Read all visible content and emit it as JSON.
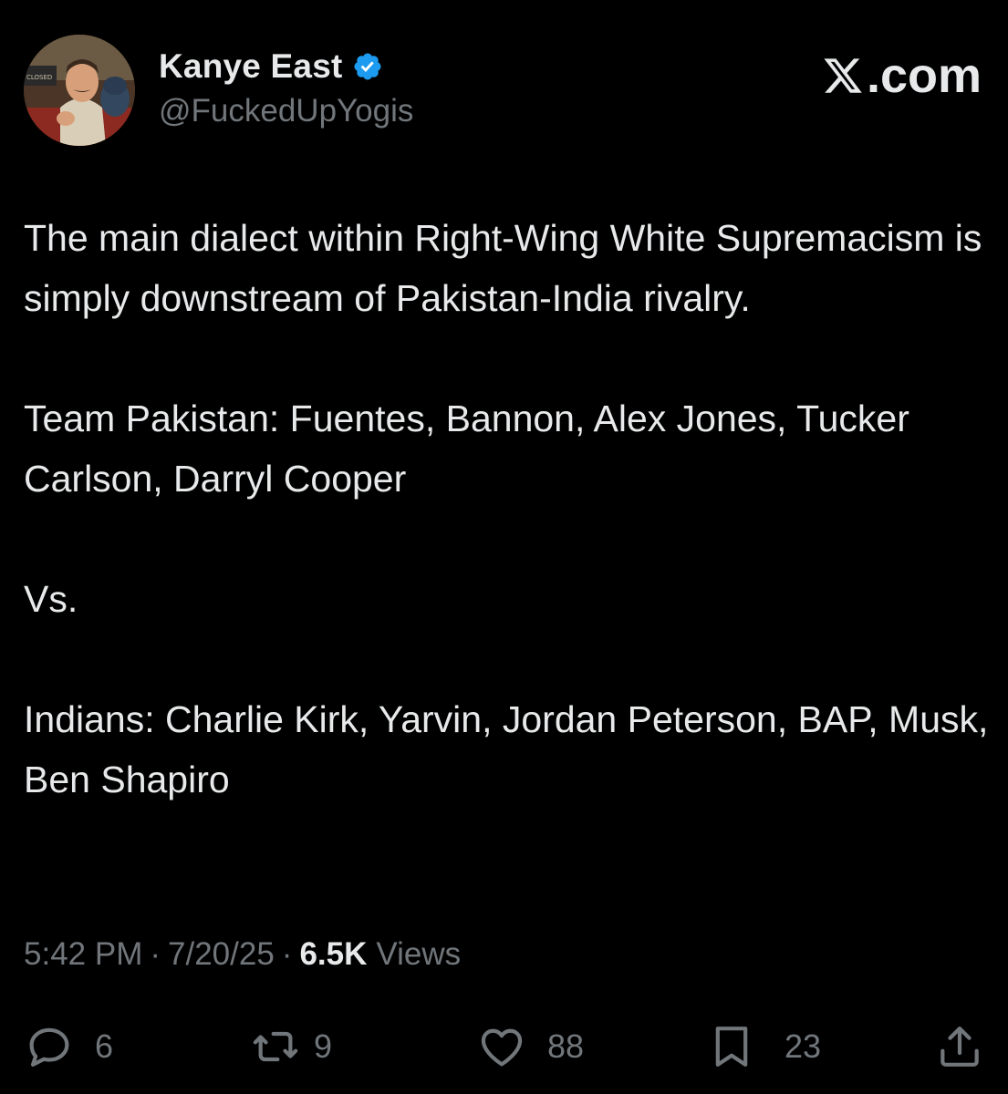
{
  "header": {
    "display_name": "Kanye East",
    "handle": "@FuckedUpYogis",
    "site_label": ".com",
    "avatar_sign_text": "CLOSED"
  },
  "post": {
    "paragraphs": [
      "The main dialect within Right-Wing White Supremacism is simply downstream of Pakistan-India rivalry.",
      "Team Pakistan: Fuentes, Bannon, Alex Jones, Tucker Carlson, Darryl Cooper",
      "Vs.",
      "Indians: Charlie Kirk, Yarvin, Jordan Peterson, BAP, Musk, Ben Shapiro"
    ]
  },
  "meta": {
    "time": "5:42 PM",
    "separator": "·",
    "date": "7/20/25",
    "views_count": "6.5K",
    "views_label": "Views"
  },
  "actions": {
    "replies": "6",
    "reposts": "9",
    "likes": "88",
    "bookmarks": "23"
  },
  "colors": {
    "background": "#000000",
    "text": "#e7e9ea",
    "muted": "#71767b",
    "verified": "#1d9bf0"
  },
  "icons": [
    "verified-badge-icon",
    "x-logo-icon",
    "reply-icon",
    "repost-icon",
    "like-icon",
    "bookmark-icon",
    "share-icon"
  ]
}
